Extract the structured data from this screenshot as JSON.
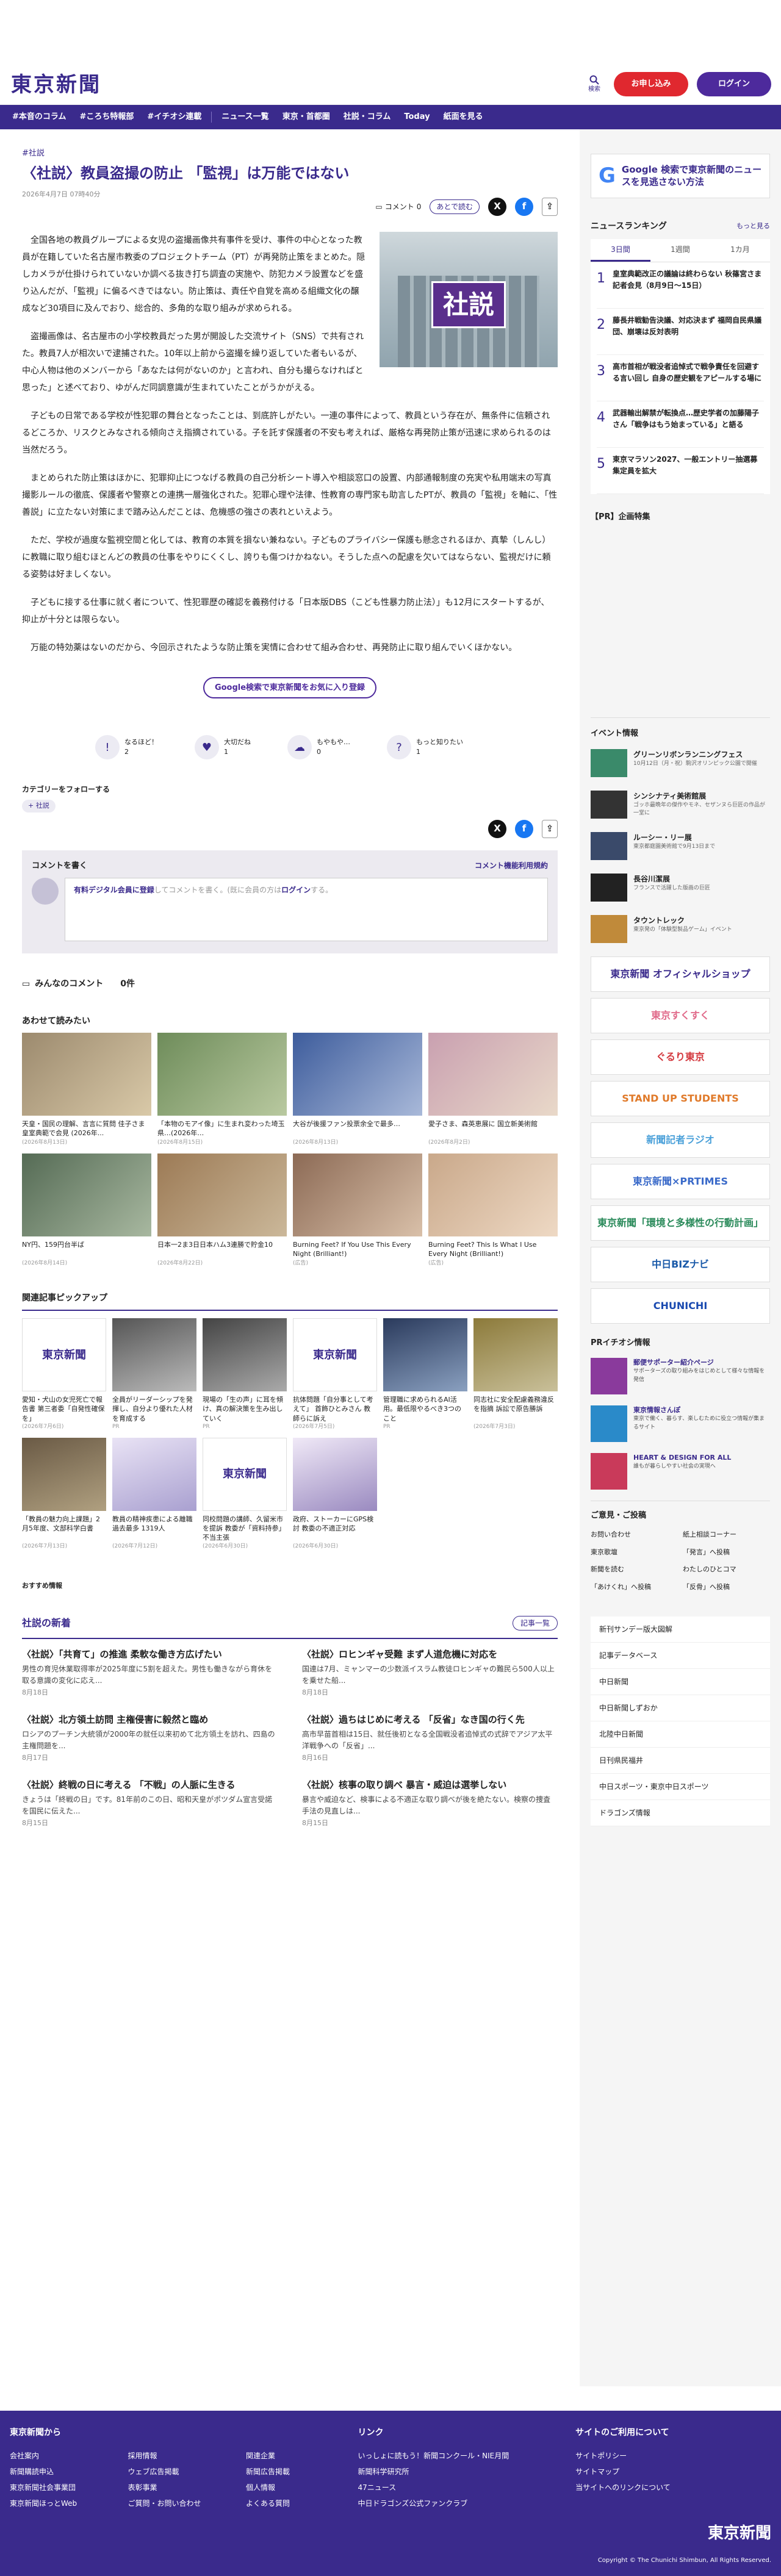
{
  "header": {
    "logo": "東京新聞",
    "search_label": "検索",
    "subscribe": "お申し込み",
    "login": "ログイン"
  },
  "nav": [
    "#本音のコラム",
    "#ころち特報部",
    "#イチオシ連載",
    "ニュース一覧",
    "東京・首都圏",
    "社説・コラム",
    "Today",
    "紙面を見る"
  ],
  "article": {
    "breadcrumb": "#社説",
    "title": "〈社説〉教員盗撮の防止 「監視」は万能ではない",
    "date": "2026年4月7日 07時40分",
    "comment_label": "コメント",
    "comment_count": "0",
    "read_later": "あとで読む",
    "photo_label": "社説",
    "paragraphs": [
      "全国各地の教員グループによる女児の盗撮画像共有事件を受け、事件の中心となった教員が在籍していた名古屋市教委のプロジェクトチーム（PT）が再発防止策をまとめた。隠しカメラが仕掛けられていないか調べる抜き打ち調査の実施や、防犯カメラ設置などを盛り込んだが、「監視」に偏るべきではない。防止策は、責任や自覚を高める組織文化の醸成など30項目に及んでおり、総合的、多角的な取り組みが求められる。",
      "盗撮画像は、名古屋市の小学校教員だった男が開設した交流サイト（SNS）で共有された。教員7人が相次いで逮捕された。10年以上前から盗撮を繰り返していた者もいるが、中心人物は他のメンバーから「あなたは何がないのか」と言われ、自分も撮らなければと思った」と述べており、ゆがんだ同調意識が生まれていたことがうかがえる。",
      "子どもの日常である学校が性犯罪の舞台となったことは、到底許しがたい。一連の事件によって、教員という存在が、無条件に信頼されるどころか、リスクとみなされる傾向さえ指摘されている。子を託す保護者の不安も考えれば、厳格な再発防止策が迅速に求められるのは当然だろう。",
      "まとめられた防止策はほかに、犯罪抑止につなげる教員の自己分析シート導入や相談窓口の設置、内部通報制度の充実や私用端末の写真撮影ルールの徹底、保護者や警察との連携一層強化された。犯罪心理や法律、性教育の専門家も助言したPTが、教員の「監視」を軸に、「性善説」に立たない対策にまで踏み込んだことは、危機感の強さの表れといえよう。",
      "ただ、学校が過度な監視空間と化しては、教育の本質を損ない兼ねない。子どものプライバシー保護も懸念されるほか、真摯（しんし）に教職に取り組むほとんどの教員の仕事をやりにくくし、誇りも傷つけかねない。そうした点への配慮を欠いてはならない、監視だけに頼る姿勢は好ましくない。",
      "子どもに接する仕事に就く者について、性犯罪歴の確認を義務付ける「日本版DBS（こども性暴力防止法）」も12月にスタートするが、抑止が十分とは限らない。",
      "万能の特効薬はないのだから、今回示されたような防止策を実情に合わせて組み合わせ、再発防止に取り組んでいくほかない。"
    ],
    "google_cta": "Google検索で東京新聞をお気に入り登録",
    "reactions": [
      {
        "label": "なるほど！",
        "count": "2"
      },
      {
        "label": "大切だね",
        "count": "1"
      },
      {
        "label": "もやもや…",
        "count": "0"
      },
      {
        "label": "もっと知りたい",
        "count": "1"
      }
    ],
    "follow_title": "カテゴリーをフォローする",
    "follow_tag": "+ 社説"
  },
  "comments": {
    "title": "コメントを書く",
    "rules": "コメント機能利用規約",
    "placeholder_a": "有料デジタル会員に登録",
    "placeholder_b": "してコメントを書く。(既に会員の方は",
    "placeholder_c": "ログイン",
    "placeholder_d": "する。",
    "list_title": "みんなのコメント",
    "list_count": "0件"
  },
  "related": {
    "title": "あわせて読みたい",
    "items": [
      {
        "cap": "天皇・国民の理解、言言に質問 佳子さま皇室典範で会見 (2026年...",
        "sub": "(2026年8月13日)",
        "c1": "#9c8a6e",
        "c2": "#d9c9a8"
      },
      {
        "cap": "「本物のモアイ像」に生まれ変わった埼玉県…(2026年…",
        "sub": "(2026年8月15日)",
        "c1": "#6e8c5a",
        "c2": "#b9c9a0"
      },
      {
        "cap": "大谷が後援ファン投票余全で最多…",
        "sub": "(2026年8月13日)",
        "c1": "#3d5c9c",
        "c2": "#a9b9d9"
      },
      {
        "cap": "愛子さま、森英恵展に 国立新美術館",
        "sub": "(2026年8月2日)",
        "c1": "#c9a0b0",
        "c2": "#e9d9c9"
      },
      {
        "cap": "NY円、159円台半ば",
        "sub": "(2026年8月14日)",
        "c1": "#556b55",
        "c2": "#a8b8a0"
      },
      {
        "cap": "日本一2ま3日日本ハム3連勝で貯金10",
        "sub": "(2026年8月22日)",
        "c1": "#9c7a55",
        "c2": "#cbb89a"
      },
      {
        "cap": "Burning Feet? If You Use This Every Night (Brilliant!)",
        "sub": "(広告)",
        "c1": "#8c6a55",
        "c2": "#d9c0a9"
      },
      {
        "cap": "Burning Feet? This Is What I Use Every Night (Brilliant!)",
        "sub": "(広告)",
        "c1": "#c9a88a",
        "c2": "#eed9c4"
      }
    ]
  },
  "pickup": {
    "title": "関連記事ピックアップ",
    "items": [
      {
        "cap": "愛知・犬山の女児死亡で報告書 第三者委「自発性確保を」",
        "sub": "(2026年7月6日)",
        "logo": true
      },
      {
        "cap": "全員がリーダーシップを発揮し、自分より優れた人材を育成する",
        "sub": "PR",
        "logo": false,
        "c1": "#555",
        "c2": "#bbb"
      },
      {
        "cap": "現場の「生の声」に耳を傾け、真の解決策を生み出していく",
        "sub": "PR",
        "logo": false,
        "c1": "#444",
        "c2": "#aaa"
      },
      {
        "cap": "抗体問題「自分事として考えて」 首飾ひとみさん 教師らに訴え",
        "sub": "(2026年7月5日)",
        "logo": true
      },
      {
        "cap": "管理職に求められるAI活用。最低限やるべき3つのこと",
        "sub": "PR",
        "logo": false,
        "c1": "#2a3a5c",
        "c2": "#8aa0c0"
      },
      {
        "cap": "同志社に安全配慮義務違反を指摘 訴訟で原告勝訴",
        "sub": "(2026年7月3日)",
        "logo": false,
        "c1": "#8c7a3a",
        "c2": "#c9c09a"
      },
      {
        "cap": "「教員の魅力向上課題」2月5年度、文部科学白書",
        "sub": "(2026年7月13日)",
        "logo": false,
        "c1": "#6a5a45",
        "c2": "#b0a080"
      },
      {
        "cap": "教員の精神疾患による離職 過去最多 1319人",
        "sub": "(2026年7月12日)",
        "logo": false,
        "c1": "#e9e3f5",
        "c2": "#a9a0d0"
      },
      {
        "cap": "同校問題の講師、久留米市を提訴 教委が「資料持参」不当主張",
        "sub": "(2026年6月30日)",
        "logo": true
      },
      {
        "cap": "政府、ストーカーにGPS検討 教委の不適正対応",
        "sub": "(2026年6月30日)",
        "logo": false,
        "c1": "#f0e9f7",
        "c2": "#9a8ac0"
      }
    ]
  },
  "recommend_label": "おすすめ情報",
  "editorials": {
    "title": "社説の新着",
    "more": "記事一覧",
    "items": [
      {
        "h": "〈社説〉「共育て」の推進 柔軟な働き方広げたい",
        "p": "男性の育児休業取得率が2025年度に5割を超えた。男性も働きながら育休を取る意識の変化に応え...",
        "d": "8月18日"
      },
      {
        "h": "〈社説〉ロヒンギャ受難 まず人道危機に対応を",
        "p": "国連は7月、ミャンマーの少数派イスラム教徒ロヒンギャの難民ら500人以上を乗せた船...",
        "d": "8月18日"
      },
      {
        "h": "〈社説〉北方領土訪問 主権侵害に毅然と臨め",
        "p": "ロシアのプーチン大統領が2000年の就任以来初めて北方領土を訪れ、四島の主権問題を...",
        "d": "8月17日"
      },
      {
        "h": "〈社説〉過ちはじめに考える 「反省」なき国の行く先",
        "p": "高市早苗首相は15日、就任後初となる全国戦没者追悼式の式辞でアジア太平洋戦争への「反省」...",
        "d": "8月16日"
      },
      {
        "h": "〈社説〉終戦の日に考える 「不戦」の人脈に生きる",
        "p": "きょうは「終戦の日」です。81年前のこの日、昭和天皇がポツダム宣言受諾を国民に伝えた...",
        "d": "8月15日"
      },
      {
        "h": "〈社説〉核事の取り調べ 暴言・威迫は選挙しない",
        "p": "暴言や威迫など、検事による不適正な取り調べが後を絶たない。検察の捜査手法の見直しは...",
        "d": "8月15日"
      }
    ]
  },
  "sidebar": {
    "google_banner": "Google 検索で東京新聞のニュースを見逃さない方法",
    "ranking_title": "ニュースランキング",
    "ranking_more": "もっと見る",
    "tabs": [
      "3日間",
      "1週間",
      "1カ月"
    ],
    "ranking": [
      "皇室典範改正の議論は終わらない 秋篠宮さま記者会見（8月9日〜15日）",
      "藤長井戦勧告決議、対応決まず 福岡自民県議団、崩壊は反対表明",
      "高市首相が戦没者追悼式で戦争責任を回避する言い回し 自身の歴史観をアピールする場に",
      "武器輸出解禁が転換点…歴史学者の加藤陽子さん「戦争はもう始まっている」と語る",
      "東京マラソン2027、一般エントリー抽選募集定員を拡大"
    ],
    "pr_title": "【PR】企画特集",
    "events_title": "イベント情報",
    "events": [
      {
        "t": "グリーンリボンランニングフェス",
        "s": "10月12日（月・祝）駒沢オリンピック公園で開催",
        "c": "#3a8a6a"
      },
      {
        "t": "シンシナティ美術館展",
        "s": "ゴッホ最晩年の傑作やモネ、セザンヌら巨匠の作品が一堂に",
        "c": "#333"
      },
      {
        "t": "ルーシー・リー展",
        "s": "東京都庭園美術館で9月13日まで",
        "c": "#3a4a6a"
      },
      {
        "t": "長谷川潔展",
        "s": "フランスで活躍した版画の巨匠",
        "c": "#222"
      },
      {
        "t": "タウントレック",
        "s": "東京発の「体験型製品ゲーム」イベント",
        "c": "#c08a3a"
      }
    ],
    "banners": [
      "東京新聞 オフィシャルショップ",
      "東京すくすく",
      "ぐるり東京",
      "STAND UP STUDENTS",
      "新聞記者ラジオ",
      "東京新聞×PRTIMES",
      "東京新聞「環境と多様性の行動計画」",
      "中日BIZナビ",
      "CHUNICHI"
    ],
    "pr2_title": "PRイチオシ情報",
    "pr2": [
      {
        "t": "郵便サポーター紹介ページ",
        "s": "サポーターズの取り組みをはじめとして様々な情報を発信",
        "c": "#8a3a9c"
      },
      {
        "t": "東京情報さんぽ",
        "s": "東京で働く、暮らす、楽しむために役立つ情報が集まるサイト",
        "c": "#2a8ac9"
      },
      {
        "t": "HEART & DESIGN FOR ALL",
        "s": "誰もが暮らしやすい社会の実現へ",
        "c": "#c93a5a"
      }
    ],
    "opinion_title": "ご意見・ご投稿",
    "opinion": [
      "お問い合わせ",
      "紙上相談コーナー",
      "東京歌壇",
      "「発言」へ投稿",
      "新聞を読む",
      "わたしのひとコマ",
      "「あけくれ」へ投稿",
      "「反骨」へ投稿"
    ],
    "links": [
      "新刊サンデー版大図解",
      "記事データベース",
      "中日新聞",
      "中日新聞しずおか",
      "北陸中日新聞",
      "日刊県民福井",
      "中日スポーツ・東京中日スポーツ",
      "ドラゴンズ情報"
    ]
  },
  "footer": {
    "col1": "東京新聞から",
    "col2": "リンク",
    "col3": "サイトのご利用について",
    "links1": [
      "会社案内",
      "採用情報",
      "関連企業",
      "新聞購読申込",
      "ウェブ広告掲載",
      "新聞広告掲載",
      "東京新聞社会事業団",
      "表彰事業",
      "個人情報",
      "東京新聞ほっとWeb",
      "ご質問・お問い合わせ",
      "よくある質問"
    ],
    "links2": [
      "いっしょに読もう！新聞コンクール・NIE月間",
      "新聞科学研究所",
      "47ニュース",
      "中日ドラゴンズ公式ファンクラブ"
    ],
    "links3": [
      "サイトポリシー",
      "サイトマップ",
      "当サイトへのリンクについて"
    ],
    "logo": "東京新聞",
    "copy": "Copyright © The Chunichi Shimbun, All Rights Reserved."
  }
}
